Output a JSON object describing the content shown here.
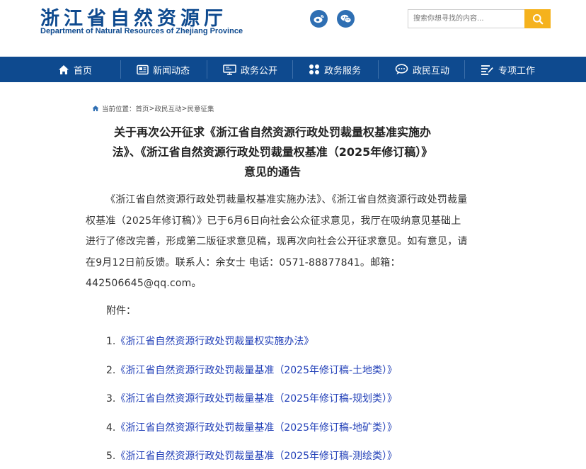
{
  "header": {
    "logo_cn": "浙江省自然资源厅",
    "logo_en": "Department of Natural Resources of Zhejiang Province",
    "search_placeholder": "搜索你想寻找的内容..."
  },
  "nav": {
    "items": [
      {
        "label": "首页",
        "icon": "home-icon"
      },
      {
        "label": "新闻动态",
        "icon": "news-icon"
      },
      {
        "label": "政务公开",
        "icon": "monitor-icon"
      },
      {
        "label": "政务服务",
        "icon": "grid-icon"
      },
      {
        "label": "政民互动",
        "icon": "chat-icon"
      },
      {
        "label": "专项工作",
        "icon": "list-icon"
      }
    ]
  },
  "breadcrumb": {
    "prefix": "当前位置：",
    "items": [
      "首页",
      "政民互动",
      "民意征集"
    ],
    "separator": ">"
  },
  "article": {
    "title_lines": [
      "关于再次公开征求《浙江省自然资源行政处罚裁量权基准实施办",
      "法》、《浙江省自然资源行政处罚裁量权基准（2025年修订稿）》",
      "意见的通告"
    ],
    "body": "《浙江省自然资源行政处罚裁量权基准实施办法》、《浙江省自然资源行政处罚裁量权基准（2025年修订稿）》已于6月6日向社会公众征求意见，我厅在吸纳意见基础上进行了修改完善，形成第二版征求意见稿，现再次向社会公开征求意见。如有意见，请在9月12日前反馈。联系人：余女士 电话：0571-88877841。邮箱：442506645@qq.com。",
    "attachment_label": "附件：",
    "attachments": [
      {
        "num": "1.",
        "title": "《浙江省自然资源行政处罚裁量权实施办法》"
      },
      {
        "num": "2.",
        "title": "《浙江省自然资源行政处罚裁量基准（2025年修订稿-土地类）》"
      },
      {
        "num": "3.",
        "title": "《浙江省自然资源行政处罚裁量基准（2025年修订稿-规划类）》"
      },
      {
        "num": "4.",
        "title": "《浙江省自然资源行政处罚裁量基准（2025年修订稿-地矿类）》"
      },
      {
        "num": "5.",
        "title": "《浙江省自然资源行政处罚裁量基准（2025年修订稿-测绘类）》"
      }
    ]
  },
  "colors": {
    "brand_blue": "#0e4a8f",
    "search_button": "#f5b21d",
    "link_blue": "#2240b8"
  }
}
